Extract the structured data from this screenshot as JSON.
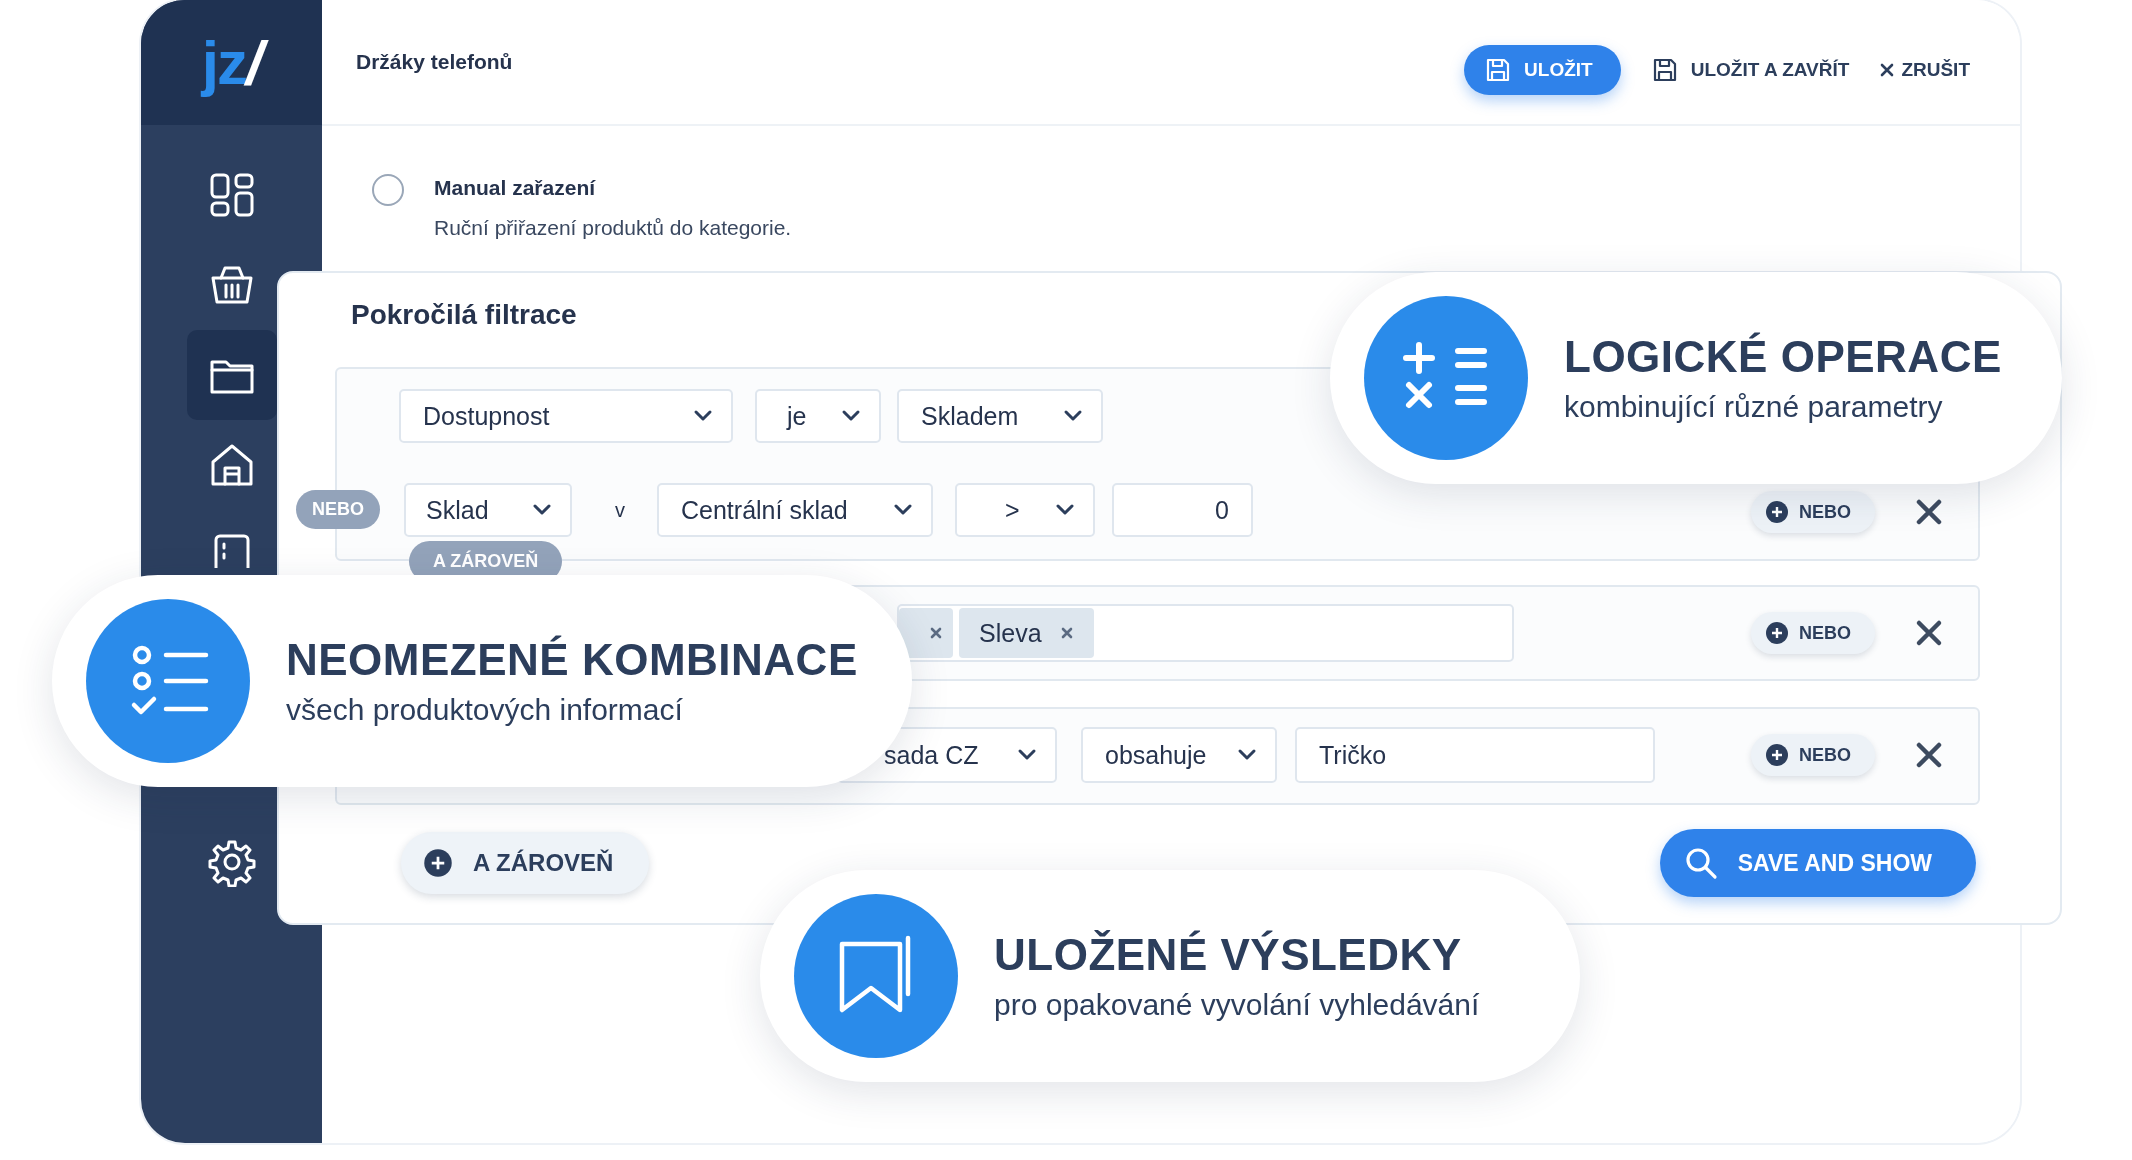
{
  "logo": {
    "letters": "jz",
    "slash": "/"
  },
  "sidebar": {
    "items": [
      {
        "kind": "dashboard",
        "selected": false
      },
      {
        "kind": "basket",
        "selected": false
      },
      {
        "kind": "folder",
        "selected": true
      },
      {
        "kind": "store",
        "selected": false
      },
      {
        "kind": "book",
        "selected": false
      },
      {
        "kind": "settings",
        "selected": false
      }
    ]
  },
  "header": {
    "title": "Držáky telefonů",
    "buttons": [
      {
        "label": "ULOŽIT",
        "kind": "primary"
      },
      {
        "label": "ULOŽIT A ZAVŘÍT",
        "kind": "save"
      },
      {
        "label": "ZRUŠIT",
        "kind": "cancel"
      }
    ]
  },
  "manual": {
    "selected": false,
    "title": "Manual zařazení",
    "description": "Ruční přiřazení produktů do kategorie."
  },
  "filter": {
    "title": "Pokročilá filtrace",
    "groups": [
      {
        "rows": [
          {
            "fields": [
              {
                "kind": "select",
                "value": "Dostupnost"
              },
              {
                "kind": "select",
                "value": "je"
              },
              {
                "kind": "select",
                "value": "Skladem"
              }
            ]
          },
          {
            "connector": "NEBO",
            "fields": [
              {
                "kind": "select",
                "value": "Sklad"
              },
              {
                "kind": "text",
                "value": "v"
              },
              {
                "kind": "select",
                "value": "Centrální sklad"
              },
              {
                "kind": "select",
                "value": ">"
              },
              {
                "kind": "input",
                "value": "0"
              }
            ]
          }
        ],
        "or_button": "NEBO",
        "and_badge": "A ZÁROVEŇ"
      },
      {
        "rows": [
          {
            "fields": [
              {
                "kind": "tags",
                "tags": [
                  "Sleva"
                ]
              }
            ]
          }
        ],
        "or_button": "NEBO"
      },
      {
        "rows": [
          {
            "fields": [
              {
                "kind": "select",
                "value": "sada CZ"
              },
              {
                "kind": "select",
                "value": "obsahuje"
              },
              {
                "kind": "input",
                "value": "Tričko"
              }
            ]
          }
        ],
        "or_button": "NEBO"
      }
    ],
    "and_button": "A ZÁROVEŇ",
    "submit": "SAVE AND SHOW"
  },
  "callouts": [
    {
      "kind": "math",
      "title": "LOGICKÉ OPERACE",
      "subtitle": "kombinující různé parametry"
    },
    {
      "kind": "checklist",
      "title": "NEOMEZENÉ KOMBINACE",
      "subtitle": "všech produktových informací"
    },
    {
      "kind": "bookmark",
      "title": "ULOŽENÉ VÝSLEDKY",
      "subtitle": "pro opakované vyvolání vyhledávání"
    }
  ]
}
